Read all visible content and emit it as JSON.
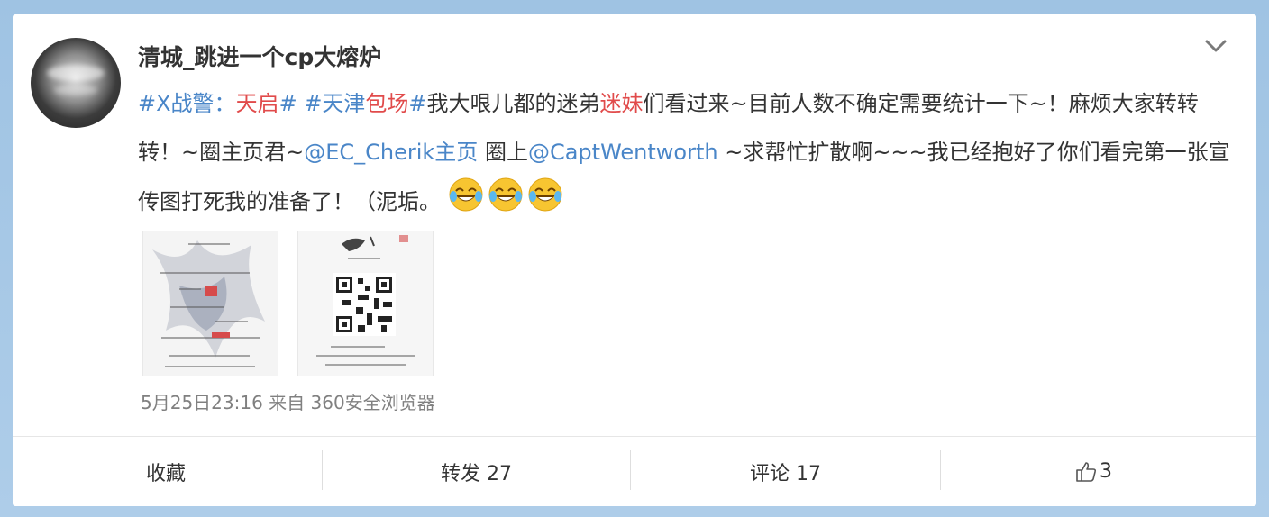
{
  "post": {
    "username": "清城_跳进一个cp大熔炉",
    "topic1_part1": "#X战警：",
    "topic1_part2": "天启",
    "topic1_part3": "#",
    "space1": " ",
    "topic2_part1": "#天津",
    "topic2_part2": "包场",
    "topic2_part3": "#",
    "text1": "我大哏儿都的迷弟",
    "text1_red": "迷妹",
    "text2": "们看过来~目前人数不确定需要统计一下~！麻烦大家转转转！~圈主页君~",
    "mention1": "@EC_Cherik主页",
    "text3": " 圈上",
    "mention2": "@CaptWentworth",
    "text4": " ~求帮忙扩散啊~~~我已经抱好了你们看完第一张宣传图打死我的准备了！（泥垢。",
    "emoji_name": "laugh-cry-emoji",
    "timestamp": "5月25日23:16 来自 360安全浏览器"
  },
  "actions": {
    "collect": "收藏",
    "repost": "转发 27",
    "comment": "评论 17",
    "like_count": "3"
  },
  "icons": {
    "expand": "chevron-down-icon",
    "like": "thumbs-up-icon"
  },
  "colors": {
    "link": "#4a86c8",
    "highlight_red": "#e14b4b",
    "background": "#a6c8e6"
  }
}
